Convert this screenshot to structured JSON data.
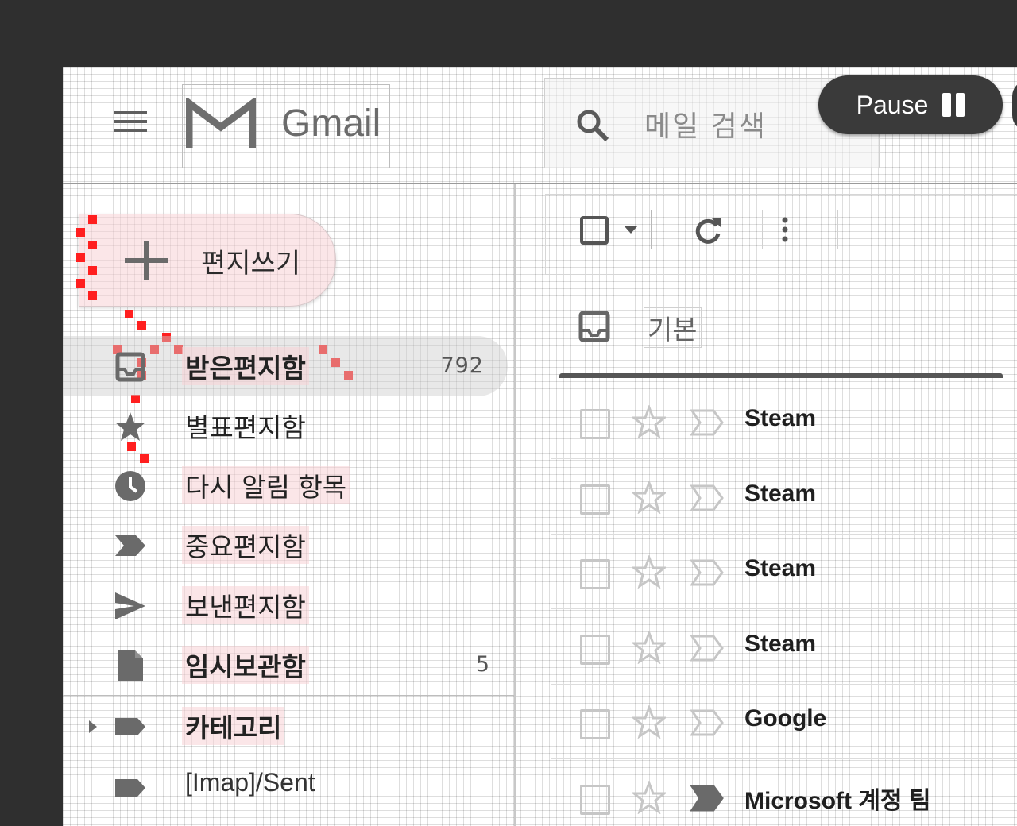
{
  "header": {
    "logo_text": "Gmail",
    "search_placeholder": "메일 검색",
    "pause_label": "Pause"
  },
  "compose": {
    "label": "편지쓰기"
  },
  "sidebar": {
    "items": [
      {
        "label": "받은편지함",
        "count": "792",
        "icon": "inbox-icon",
        "selected": true
      },
      {
        "label": "별표편지함",
        "icon": "star-icon"
      },
      {
        "label": "다시 알림 항목",
        "icon": "clock-icon"
      },
      {
        "label": "중요편지함",
        "icon": "important-icon"
      },
      {
        "label": "보낸편지함",
        "icon": "send-icon"
      },
      {
        "label": "임시보관함",
        "count": "5",
        "icon": "draft-icon",
        "bold": true
      },
      {
        "label": "카테고리",
        "icon": "label-icon",
        "bold": true,
        "expandable": true
      },
      {
        "label": "[Imap]/Sent",
        "icon": "label-icon"
      }
    ]
  },
  "tabs": {
    "primary_label": "기본"
  },
  "messages": [
    {
      "sender": "Steam",
      "important": false
    },
    {
      "sender": "Steam",
      "important": false
    },
    {
      "sender": "Steam",
      "important": false
    },
    {
      "sender": "Steam",
      "important": false
    },
    {
      "sender": "Google",
      "important": false
    },
    {
      "sender": "Microsoft 계정 팀",
      "important": true
    }
  ],
  "colors": {
    "highlight_pink": "#f8d2d6",
    "marker_red": "#ff1f1f",
    "pause_bg": "#3a3a3a",
    "icon_grey": "#6a6a6a"
  }
}
